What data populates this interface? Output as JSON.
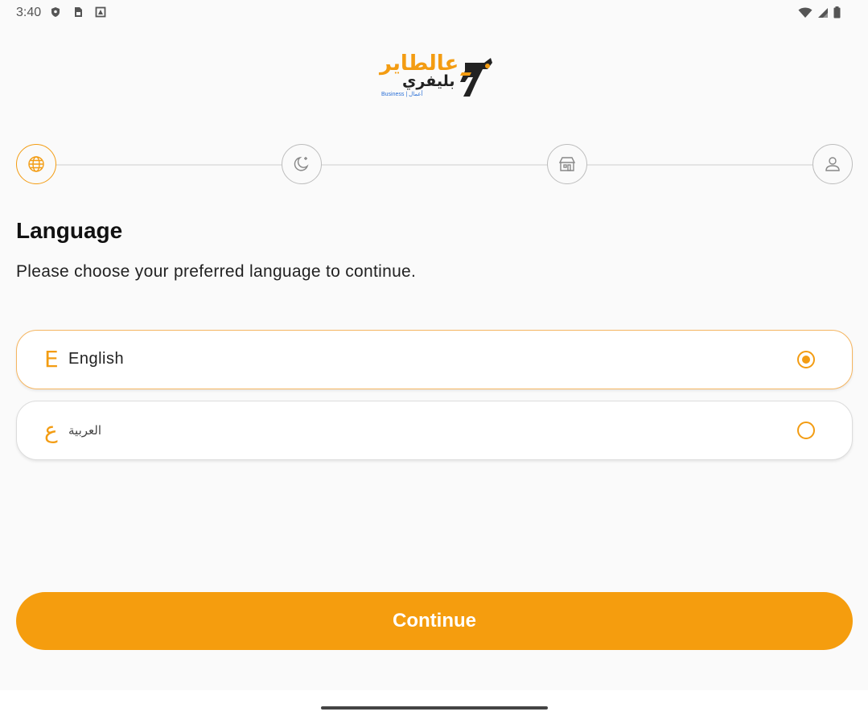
{
  "status_bar": {
    "time": "3:40",
    "left_icons": [
      "shield-icon",
      "sim-card-icon",
      "notification-icon"
    ],
    "right_icons": [
      "wifi-icon",
      "signal-icon",
      "battery-icon"
    ]
  },
  "logo": {
    "line1": "عالطاير",
    "line2": "بليفري",
    "small": "Business | أعمال"
  },
  "stepper": {
    "steps": [
      {
        "icon": "globe-icon",
        "active": true
      },
      {
        "icon": "moon-stars-icon",
        "active": false
      },
      {
        "icon": "store-icon",
        "active": false
      },
      {
        "icon": "user-icon",
        "active": false
      }
    ]
  },
  "page": {
    "title": "Language",
    "subtitle": "Please choose your preferred language to continue."
  },
  "languages": [
    {
      "glyph": "E",
      "label": "English",
      "selected": true
    },
    {
      "glyph": "ع",
      "label": "العربية",
      "selected": false
    }
  ],
  "continue_label": "Continue",
  "colors": {
    "accent": "#f39c12",
    "button": "#f59d0e",
    "background": "#fafafa"
  }
}
